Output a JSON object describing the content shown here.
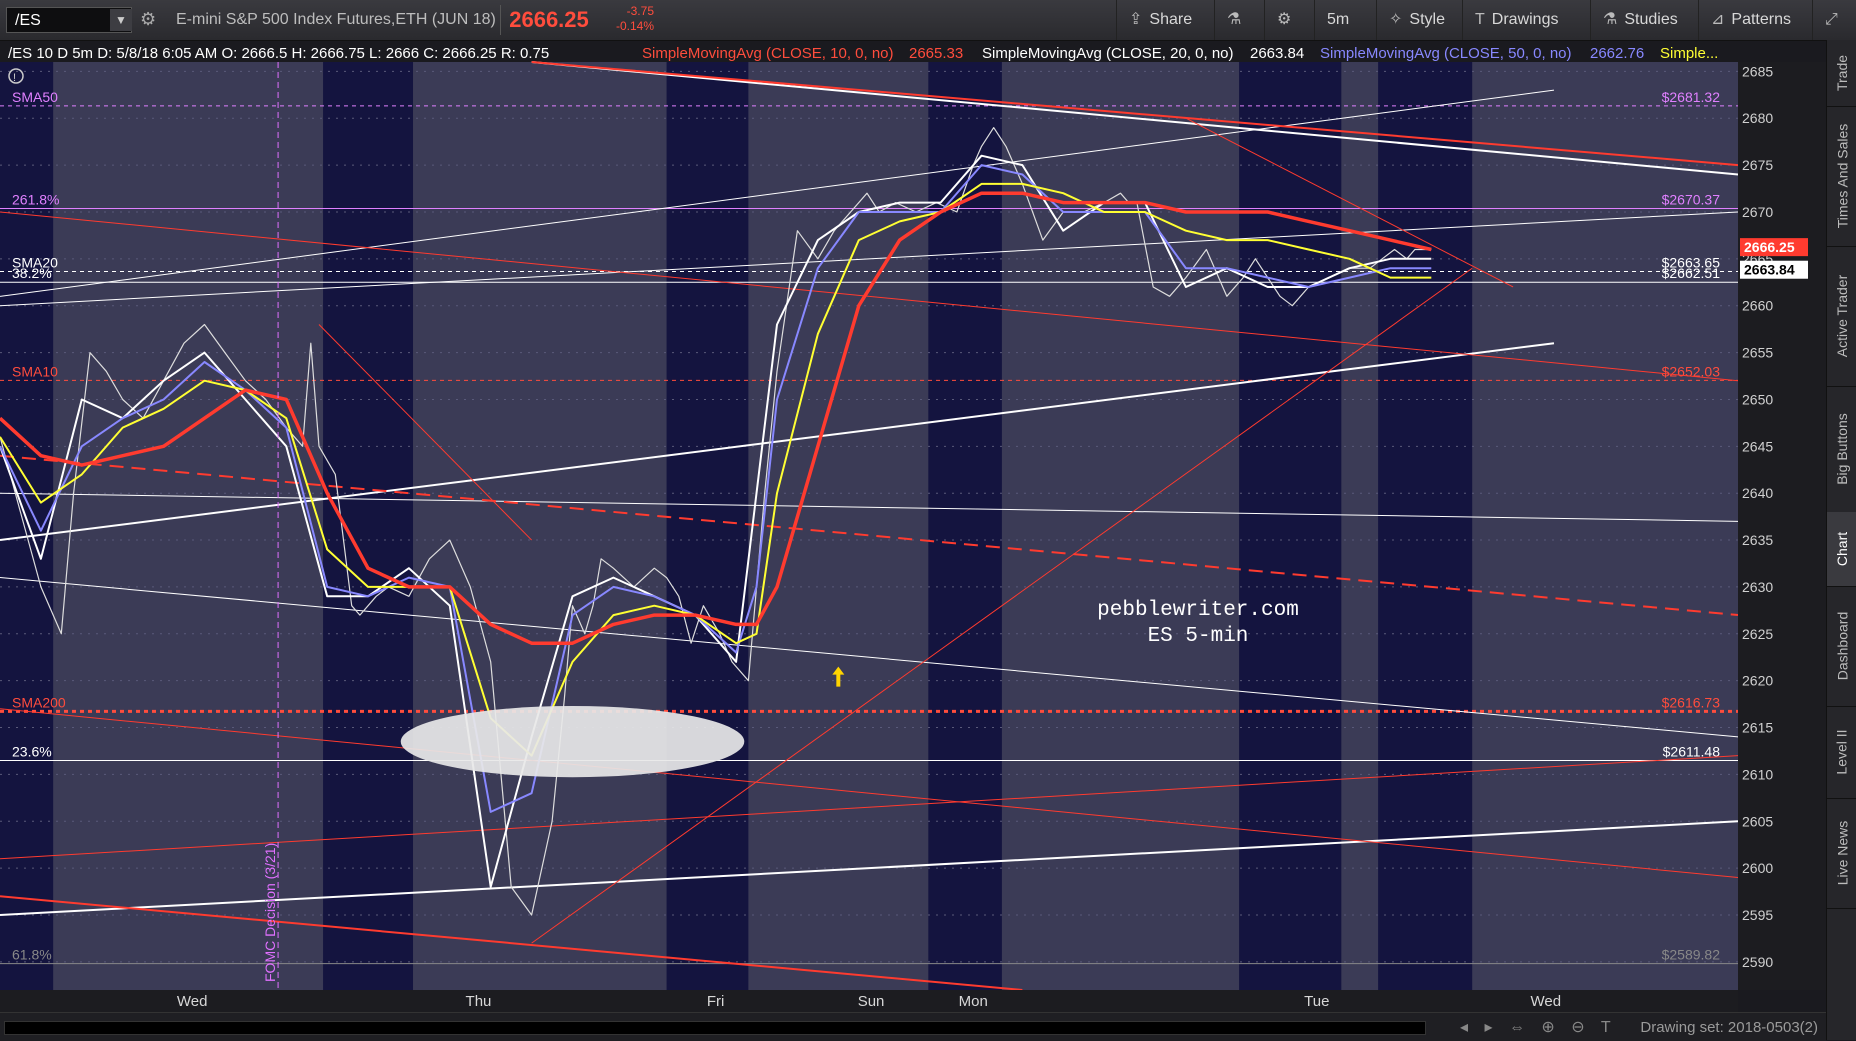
{
  "toolbar": {
    "symbol": "/ES",
    "description": "E-mini S&P 500 Index Futures,ETH (JUN 18)",
    "last_price": "2666.25",
    "change": "-3.75",
    "change_pct": "-0.14%",
    "share_label": "Share",
    "interval_label": "5m",
    "style_label": "Style",
    "drawings_label": "Drawings",
    "studies_label": "Studies",
    "patterns_label": "Patterns"
  },
  "header": {
    "info": "/ES 10 D 5m  D: 5/8/18 6:05 AM  O: 2666.5  H: 2666.75  L: 2666  C: 2666.25  R: 0.75",
    "sma10": "SimpleMovingAvg (CLOSE, 10, 0, no)",
    "sma10_val": "2665.33",
    "sma20": "SimpleMovingAvg (CLOSE, 20, 0, no)",
    "sma20_val": "2663.84",
    "sma50": "SimpleMovingAvg (CLOSE, 50, 0, no)",
    "sma50_val": "2662.76",
    "more": "Simple..."
  },
  "watermark": {
    "line1": "pebblewriter.com",
    "line2": "ES 5-min"
  },
  "fomc_label": "FOMC Decision (3/21)",
  "right_rail": [
    "Trade",
    "Times And Sales",
    "Active Trader",
    "Big Buttons",
    "Chart",
    "Dashboard",
    "Level II",
    "Live News"
  ],
  "bottom": {
    "drawing_set": "Drawing set: 2018-0503(2)"
  },
  "chart_data": {
    "type": "line",
    "title": "",
    "ylim": [
      2587,
      2686
    ],
    "y_ticks": [
      2590,
      2595,
      2600,
      2605,
      2610,
      2615,
      2620,
      2625,
      2630,
      2635,
      2640,
      2645,
      2650,
      2655,
      2660,
      2665,
      2670,
      2675,
      2680,
      2685
    ],
    "x_day_labels": [
      "Wed",
      "Thu",
      "Fri",
      "Sun",
      "Mon",
      "Tue",
      "Wed"
    ],
    "session_shading": [
      {
        "from": 0,
        "to": 13
      },
      {
        "from": 79,
        "to": 101
      },
      {
        "from": 163,
        "to": 183
      },
      {
        "from": 227,
        "to": 245
      },
      {
        "from": 303,
        "to": 328
      },
      {
        "from": 337,
        "to": 360
      }
    ],
    "levels": [
      {
        "label": "SMA50",
        "value": "$2681.32",
        "y": 2681.32,
        "color": "#e080ff"
      },
      {
        "label": "261.8%",
        "value": "$2670.37",
        "y": 2670.37,
        "color": "#e080ff"
      },
      {
        "label": "SMA20",
        "value": "$2663.65",
        "y": 2663.65,
        "color": "#ffffff"
      },
      {
        "label": "38.2%",
        "value": "$2662.51",
        "y": 2662.51,
        "color": "#ffffff"
      },
      {
        "label": "SMA10",
        "value": "$2652.03",
        "y": 2652.03,
        "color": "#ff4d3d"
      },
      {
        "label": "SMA200",
        "value": "$2616.73",
        "y": 2616.73,
        "color": "#ff4d3d"
      },
      {
        "label": "23.6%",
        "value": "$2611.48",
        "y": 2611.48,
        "color": "#ffffff"
      },
      {
        "label": "61.8%",
        "value": "$2589.82",
        "y": 2589.82,
        "color": "#888888"
      }
    ],
    "price_flags": [
      {
        "text": "2666.25",
        "y": 2666.25,
        "bg": "#ff3b2f",
        "fg": "#ffffff"
      },
      {
        "text": "2663.84",
        "y": 2663.84,
        "bg": "#ffffff",
        "fg": "#000000"
      }
    ],
    "series": [
      {
        "name": "price",
        "color": "#dddddd",
        "x": [
          0,
          5,
          10,
          15,
          18,
          22,
          26,
          30,
          35,
          40,
          45,
          50,
          55,
          60,
          65,
          70,
          74,
          76,
          78,
          82,
          86,
          88,
          92,
          95,
          100,
          105,
          110,
          115,
          120,
          125,
          130,
          135,
          138,
          140,
          143,
          145,
          147,
          150,
          155,
          160,
          163,
          166,
          169,
          172,
          176,
          179,
          183,
          187,
          190,
          195,
          200,
          204,
          208,
          212,
          215,
          219,
          224,
          229,
          234,
          238,
          240,
          243,
          246,
          250,
          255,
          260,
          265,
          270,
          274,
          276,
          278,
          282,
          286,
          290,
          295,
          300,
          304,
          307,
          310,
          313,
          316,
          320,
          325,
          330,
          335,
          338,
          341,
          344,
          346,
          348,
          350
        ],
        "values": [
          2646,
          2638,
          2630,
          2625,
          2640,
          2655,
          2653,
          2650,
          2648,
          2652,
          2656,
          2658,
          2655,
          2652,
          2650,
          2647,
          2645,
          2656,
          2645,
          2642,
          2628,
          2627,
          2629,
          2630,
          2629,
          2633,
          2635,
          2630,
          2622,
          2598,
          2595,
          2605,
          2618,
          2628,
          2625,
          2628,
          2633,
          2632,
          2630,
          2632,
          2631,
          2629,
          2624,
          2628,
          2625,
          2622,
          2620,
          2640,
          2653,
          2668,
          2665,
          2668,
          2670,
          2672,
          2670,
          2671,
          2670,
          2671,
          2670,
          2675,
          2677,
          2679,
          2677,
          2673,
          2667,
          2670,
          2670,
          2671,
          2672,
          2671,
          2671,
          2662,
          2661,
          2663,
          2666,
          2661,
          2663,
          2665,
          2663,
          2661,
          2660,
          2662,
          2663,
          2664,
          2664,
          2665,
          2666,
          2665,
          2666,
          2666,
          2666
        ]
      },
      {
        "name": "SMA10",
        "color": "#ffffff",
        "x": [
          0,
          10,
          20,
          30,
          40,
          50,
          60,
          70,
          80,
          90,
          100,
          110,
          120,
          130,
          140,
          150,
          160,
          170,
          180,
          185,
          190,
          200,
          210,
          220,
          230,
          240,
          250,
          260,
          270,
          280,
          290,
          300,
          310,
          320,
          330,
          340,
          350
        ],
        "values": [
          2645,
          2633,
          2650,
          2648,
          2652,
          2655,
          2650,
          2645,
          2629,
          2629,
          2632,
          2628,
          2598,
          2614,
          2629,
          2631,
          2629,
          2627,
          2622,
          2640,
          2658,
          2667,
          2670,
          2671,
          2671,
          2676,
          2675,
          2668,
          2671,
          2671,
          2662,
          2664,
          2662,
          2662,
          2664,
          2665,
          2665
        ]
      },
      {
        "name": "SMA20",
        "color": "#8888ff",
        "x": [
          0,
          10,
          20,
          30,
          40,
          50,
          60,
          70,
          80,
          90,
          100,
          110,
          120,
          130,
          140,
          150,
          160,
          170,
          180,
          185,
          190,
          200,
          210,
          220,
          230,
          240,
          250,
          260,
          270,
          280,
          290,
          300,
          310,
          320,
          330,
          340,
          350
        ],
        "values": [
          2645,
          2636,
          2645,
          2648,
          2650,
          2654,
          2651,
          2647,
          2630,
          2629,
          2631,
          2630,
          2606,
          2608,
          2627,
          2630,
          2629,
          2627,
          2623,
          2630,
          2650,
          2664,
          2670,
          2670,
          2670,
          2675,
          2674,
          2670,
          2670,
          2670,
          2664,
          2664,
          2663,
          2662,
          2663,
          2664,
          2664
        ]
      },
      {
        "name": "SMA50",
        "color": "#ffff33",
        "x": [
          0,
          10,
          20,
          30,
          40,
          50,
          60,
          70,
          80,
          90,
          100,
          110,
          120,
          130,
          140,
          150,
          160,
          170,
          180,
          185,
          190,
          200,
          210,
          220,
          230,
          240,
          250,
          260,
          270,
          280,
          290,
          300,
          310,
          320,
          330,
          340,
          350
        ],
        "values": [
          2646,
          2639,
          2642,
          2647,
          2649,
          2652,
          2651,
          2648,
          2634,
          2630,
          2630,
          2630,
          2616,
          2612,
          2622,
          2627,
          2628,
          2627,
          2624,
          2625,
          2640,
          2657,
          2667,
          2669,
          2670,
          2673,
          2673,
          2672,
          2670,
          2670,
          2668,
          2667,
          2667,
          2666,
          2665,
          2663,
          2663
        ]
      },
      {
        "name": "SMA200",
        "color": "#ff3b2f",
        "x": [
          0,
          10,
          20,
          30,
          40,
          50,
          60,
          70,
          80,
          90,
          100,
          110,
          120,
          130,
          140,
          150,
          160,
          170,
          180,
          185,
          190,
          200,
          210,
          220,
          230,
          240,
          250,
          260,
          270,
          280,
          290,
          300,
          310,
          320,
          330,
          340,
          350
        ],
        "values": [
          2648,
          2644,
          2643,
          2644,
          2645,
          2648,
          2651,
          2650,
          2640,
          2632,
          2630,
          2630,
          2626,
          2624,
          2624,
          2626,
          2627,
          2627,
          2626,
          2626,
          2630,
          2645,
          2660,
          2667,
          2670,
          2672,
          2672,
          2671,
          2671,
          2671,
          2670,
          2670,
          2670,
          2669,
          2668,
          2667,
          2666
        ]
      }
    ],
    "trendlines": [
      {
        "p1": [
          0,
          2631
        ],
        "p2": [
          425,
          2614
        ],
        "color": "#ffffff",
        "width": 1
      },
      {
        "p1": [
          0,
          2640
        ],
        "p2": [
          425,
          2637
        ],
        "color": "#ffffff",
        "width": 1
      },
      {
        "p1": [
          0,
          2635
        ],
        "p2": [
          380,
          2656
        ],
        "color": "#ffffff",
        "width": 2
      },
      {
        "p1": [
          0,
          2595
        ],
        "p2": [
          425,
          2605
        ],
        "color": "#ffffff",
        "width": 2
      },
      {
        "p1": [
          0,
          2661
        ],
        "p2": [
          380,
          2683
        ],
        "color": "#ffffff",
        "width": 1
      },
      {
        "p1": [
          0,
          2660
        ],
        "p2": [
          425,
          2670
        ],
        "color": "#ffffff",
        "width": 1
      },
      {
        "p1": [
          130,
          2686
        ],
        "p2": [
          425,
          2674
        ],
        "color": "#ffffff",
        "width": 2
      },
      {
        "p1": [
          130,
          2686
        ],
        "p2": [
          425,
          2675
        ],
        "color": "#ff3b2f",
        "width": 2
      },
      {
        "p1": [
          0,
          2670
        ],
        "p2": [
          425,
          2652
        ],
        "color": "#ff3b2f",
        "width": 1
      },
      {
        "p1": [
          0,
          2644
        ],
        "p2": [
          425,
          2627
        ],
        "color": "#ff3b2f",
        "width": 2,
        "dash": true
      },
      {
        "p1": [
          0,
          2617
        ],
        "p2": [
          425,
          2599
        ],
        "color": "#ff3b2f",
        "width": 1
      },
      {
        "p1": [
          0,
          2601
        ],
        "p2": [
          425,
          2612
        ],
        "color": "#ff3b2f",
        "width": 1
      },
      {
        "p1": [
          0,
          2597
        ],
        "p2": [
          250,
          2587
        ],
        "color": "#ff3b2f",
        "width": 2
      },
      {
        "p1": [
          130,
          2592
        ],
        "p2": [
          360,
          2664
        ],
        "color": "#ff3b2f",
        "width": 1
      },
      {
        "p1": [
          78,
          2658
        ],
        "p2": [
          130,
          2635
        ],
        "color": "#ff3b2f",
        "width": 1
      },
      {
        "p1": [
          290,
          2680
        ],
        "p2": [
          370,
          2662
        ],
        "color": "#ff3b2f",
        "width": 1
      }
    ],
    "ellipse": {
      "cx": 140,
      "cy": 2613.5,
      "rx": 42,
      "ry": 3.8
    },
    "fomc_x": 68,
    "arrow": {
      "x": 205,
      "y": 2620
    },
    "grid": true
  }
}
